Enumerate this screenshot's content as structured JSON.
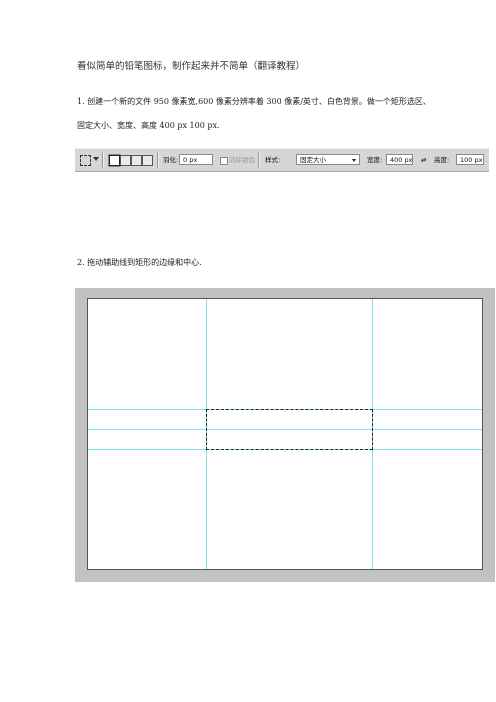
{
  "doc": {
    "title": "看似简单的铅笔图标，制作起来并不简单（翻译教程）",
    "step1_line1": "1.  创建一个新的文件 950 像素宽,600 像素分辨率着 300 像素/英寸、白色背景。做一个矩形选区、",
    "step1_line2": "固定大小、宽度、高度 400 px 100 px.",
    "step2": "2.  拖动辅助线到矩形的边缘和中心."
  },
  "toolbar": {
    "feather_label": "羽化:",
    "feather_value": "0 px",
    "antialias_label": "消除锯齿",
    "style_label": "样式:",
    "style_value": "固定大小",
    "width_label": "宽度:",
    "width_value": "400 px",
    "swap_icon": "⇄",
    "height_label": "高度:",
    "height_value": "100 px"
  },
  "colors": {
    "guide": "#7fe3ee",
    "canvas_bg": "#c2c2c2",
    "toolbar_bg": "#d6d6d6"
  }
}
